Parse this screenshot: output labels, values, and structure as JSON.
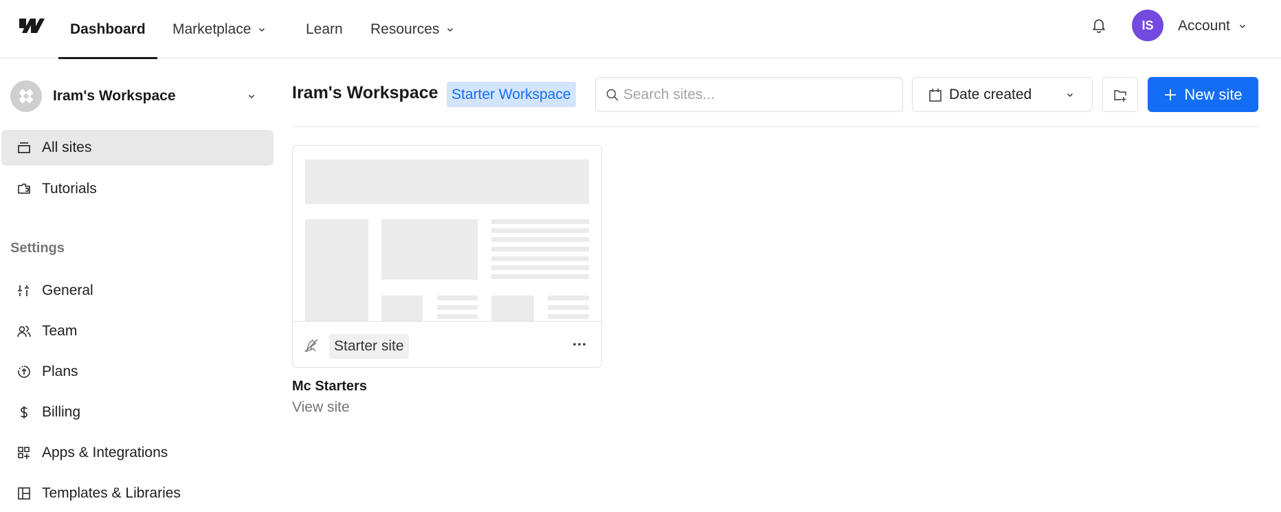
{
  "topnav": {
    "logo": "webflow-logo",
    "items": [
      {
        "label": "Dashboard",
        "active": true,
        "dropdown": false
      },
      {
        "label": "Marketplace",
        "active": false,
        "dropdown": true
      },
      {
        "label": "Learn",
        "active": false,
        "dropdown": false
      },
      {
        "label": "Resources",
        "active": false,
        "dropdown": true
      }
    ],
    "notifications_icon": "bell-icon",
    "avatar_initials": "IS",
    "avatar_color": "#7349e0",
    "account_label": "Account"
  },
  "sidebar": {
    "workspace_name": "Iram's Workspace",
    "items": [
      {
        "label": "All sites",
        "icon": "sites-icon",
        "active": true
      },
      {
        "label": "Tutorials",
        "icon": "tutorials-icon",
        "active": false
      }
    ],
    "settings_heading": "Settings",
    "settings_items": [
      {
        "label": "General",
        "icon": "sliders-icon"
      },
      {
        "label": "Team",
        "icon": "team-icon"
      },
      {
        "label": "Plans",
        "icon": "plans-icon"
      },
      {
        "label": "Billing",
        "icon": "dollar-icon"
      },
      {
        "label": "Apps & Integrations",
        "icon": "apps-icon"
      },
      {
        "label": "Templates & Libraries",
        "icon": "templates-icon"
      }
    ]
  },
  "main": {
    "title": "Iram's Workspace",
    "badge": "Starter Workspace",
    "search": {
      "placeholder": "Search sites...",
      "value": ""
    },
    "sort": {
      "selected": "Date created"
    },
    "new_folder_icon": "folder-plus-icon",
    "new_site_label": "New site",
    "accent_color": "#146ef5",
    "sites": [
      {
        "name": "Mc Starters",
        "plan": "Starter site",
        "link_label": "View site",
        "published": false
      }
    ]
  }
}
